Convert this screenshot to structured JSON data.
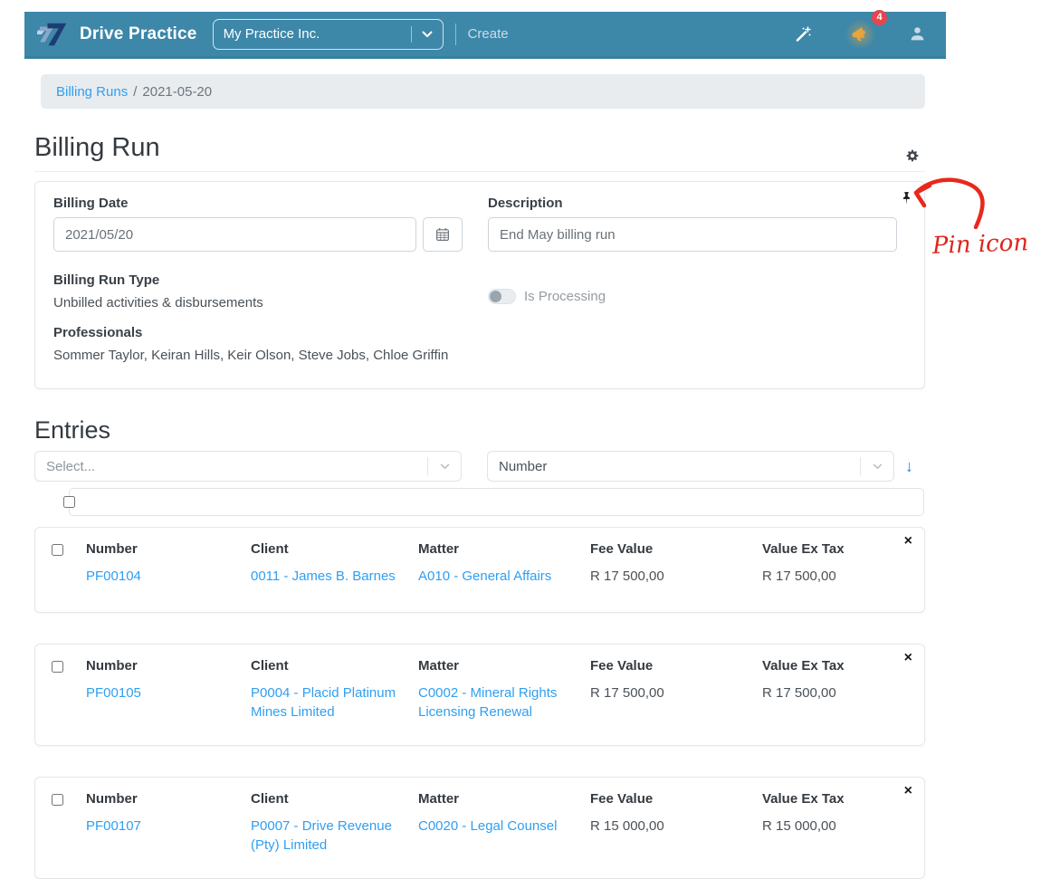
{
  "navbar": {
    "brand": "Drive Practice",
    "practice_selector": {
      "value": "My Practice Inc."
    },
    "create_label": "Create",
    "notification_count": "4"
  },
  "breadcrumb": {
    "link": "Billing Runs",
    "separator": "/",
    "current": "2021-05-20"
  },
  "billing_run": {
    "title": "Billing Run",
    "billing_date": {
      "label": "Billing Date",
      "value": "2021/05/20"
    },
    "description": {
      "label": "Description",
      "value": "End May billing run"
    },
    "billing_run_type": {
      "label": "Billing Run Type",
      "value": "Unbilled activities & disbursements"
    },
    "is_processing": {
      "label": "Is Processing",
      "state": "off"
    },
    "professionals": {
      "label": "Professionals",
      "value": "Sommer Taylor, Keiran Hills, Keir Olson, Steve Jobs, Chloe Griffin"
    }
  },
  "entries": {
    "title": "Entries",
    "filter_placeholder": "Select...",
    "sort_field": "Number",
    "columns": [
      "Number",
      "Client",
      "Matter",
      "Fee Value",
      "Value Ex Tax"
    ],
    "rows": [
      {
        "number": "PF00104",
        "client": "0011 - James B. Barnes",
        "matter": "A010 - General Affairs",
        "fee_value": "R 17 500,00",
        "value_ex_tax": "R 17 500,00"
      },
      {
        "number": "PF00105",
        "client": "P0004 - Placid Platinum Mines Limited",
        "matter": "C0002 - Mineral Rights Licensing Renewal",
        "fee_value": "R 17 500,00",
        "value_ex_tax": "R 17 500,00"
      },
      {
        "number": "PF00107",
        "client": "P0007 - Drive Revenue (Pty) Limited",
        "matter": "C0020 - Legal Counsel",
        "fee_value": "R 15 000,00",
        "value_ex_tax": "R 15 000,00"
      }
    ]
  },
  "annotation": {
    "text": "Pin icon"
  },
  "icons": {
    "close": "×",
    "sort_desc": "↓"
  },
  "colors": {
    "navbar_bg": "#3d87a9",
    "link_blue": "#2f9ff2",
    "badge_red": "#e5464e",
    "megaphone_orange": "#e9a43b",
    "annotation_red": "#e0241c",
    "breadcrumb_bg": "#e8ecef"
  }
}
